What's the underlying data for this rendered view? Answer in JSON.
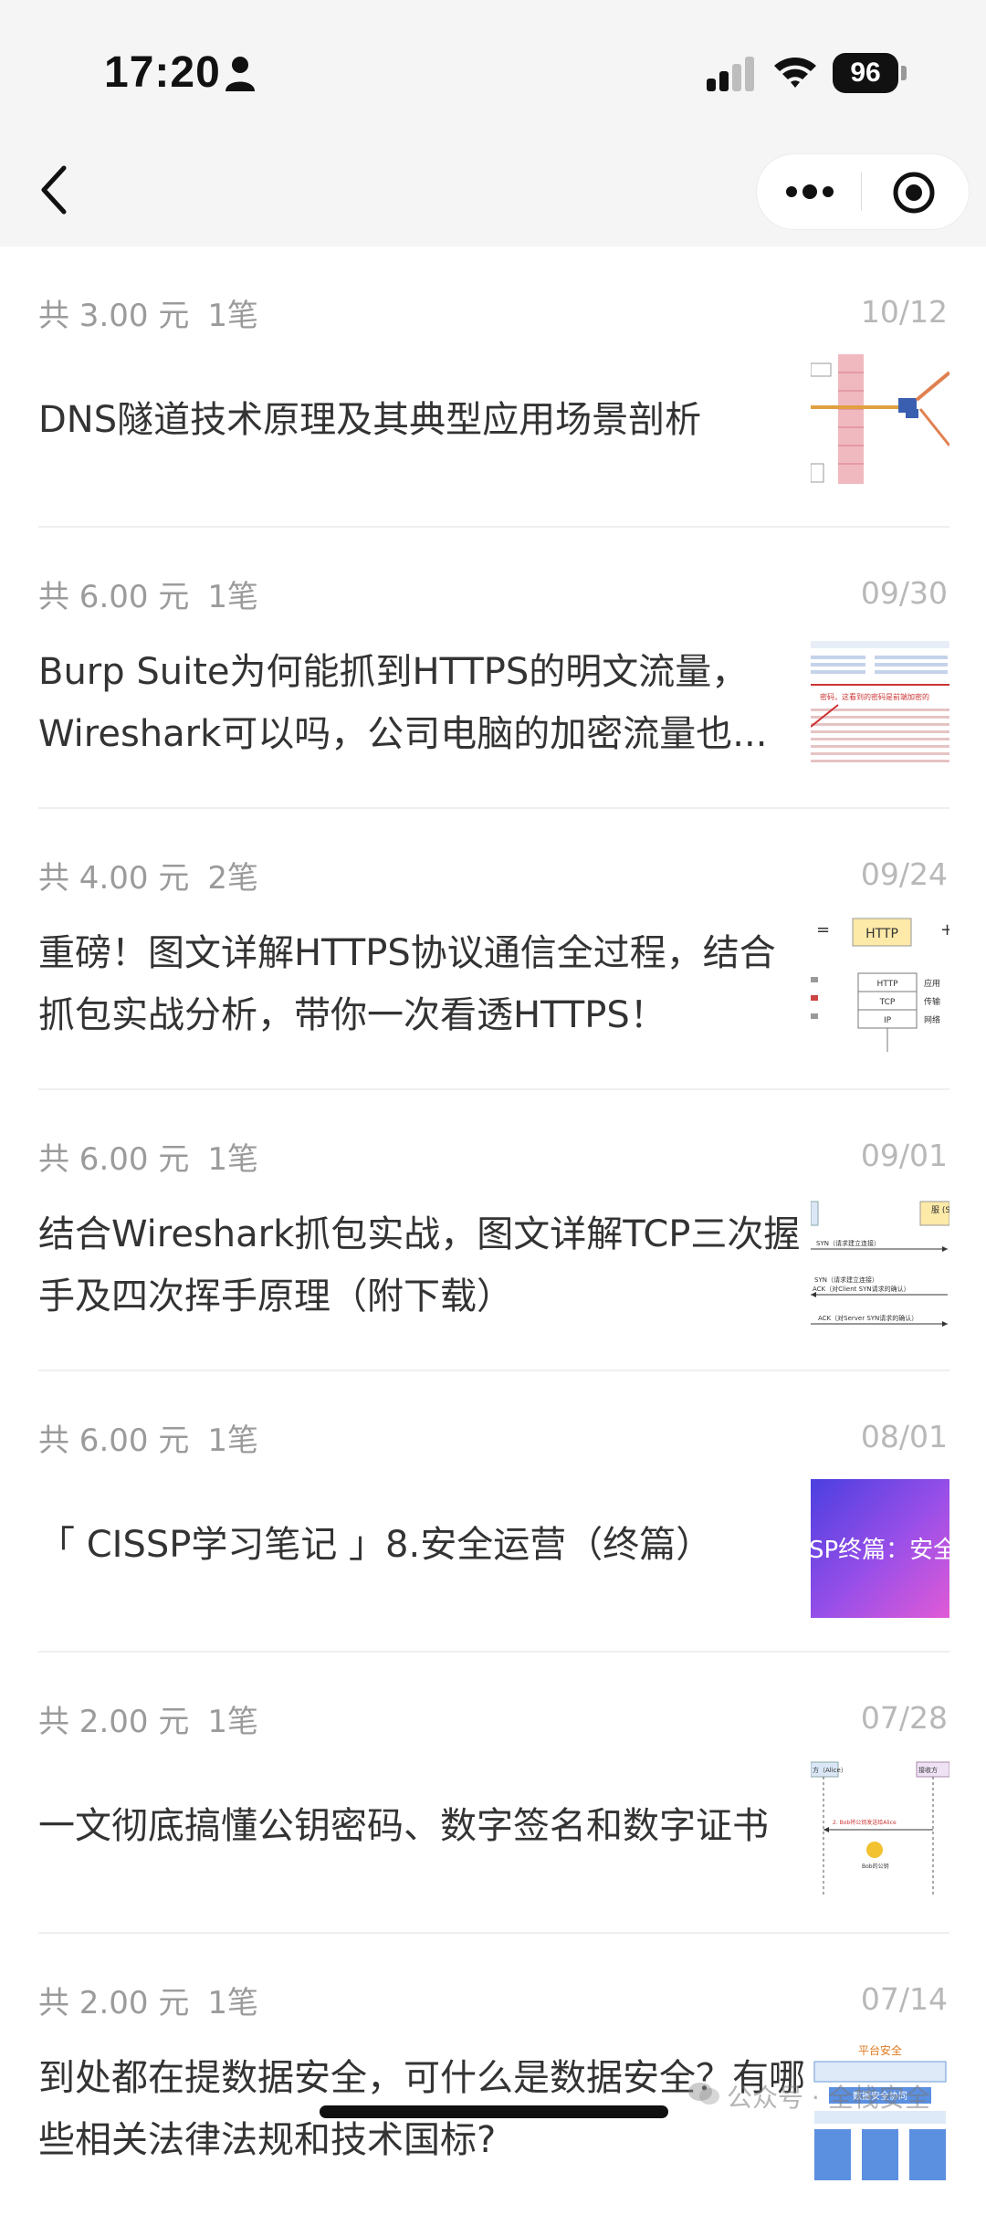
{
  "status_bar": {
    "time": "17:20",
    "battery": "96"
  },
  "nav": {
    "back_icon": "chevron-left-icon",
    "more_icon": "more-dots-icon",
    "target_icon": "target-icon"
  },
  "items": [
    {
      "amount": "共 3.00 元",
      "count": "1笔",
      "date": "10/12",
      "title": "DNS隧道技术原理及其典型应用场景剖析"
    },
    {
      "amount": "共 6.00 元",
      "count": "1笔",
      "date": "09/30",
      "title": "Burp Suite为何能抓到HTTPS的明文流量，Wireshark可以吗，公司电脑的加密流量也..."
    },
    {
      "amount": "共 4.00 元",
      "count": "2笔",
      "date": "09/24",
      "title": "重磅！图文详解HTTPS协议通信全过程，结合抓包实战分析，带你一次看透HTTPS！"
    },
    {
      "amount": "共 6.00 元",
      "count": "1笔",
      "date": "09/01",
      "title": "结合Wireshark抓包实战，图文详解TCP三次握手及四次挥手原理（附下载）"
    },
    {
      "amount": "共 6.00 元",
      "count": "1笔",
      "date": "08/01",
      "title": "「 CISSP学习笔记 」8.安全运营（终篇）"
    },
    {
      "amount": "共 2.00 元",
      "count": "1笔",
      "date": "07/28",
      "title": "一文彻底搞懂公钥密码、数字签名和数字证书"
    },
    {
      "amount": "共 2.00 元",
      "count": "1笔",
      "date": "07/14",
      "title": "到处都在提数据安全，可什么是数据安全？有哪些相关法律法规和技术国标?"
    }
  ],
  "thumb_text": {
    "t2": "密码，这看到的密码是前端加密的",
    "t3_http": "HTTP",
    "t3_tcp": "TCP",
    "t3_ip": "IP",
    "t3_eq": "=",
    "t3_plus": "+",
    "t3_r1": "应用",
    "t3_r2": "传输",
    "t3_r3": "网络",
    "t4_syn": "SYN（请求建立连接）",
    "t4_syn2": "SYN（请求建立连接）",
    "t4_ack": "ACK（对Client SYN请求的确认）",
    "t4_ack2": "ACK（对Server SYN请求的确认）",
    "t4_box": "服\n(Se",
    "t5": "SP终篇：安全",
    "t6_alice": "方（Alice）",
    "t6_bob": "接收方",
    "t6_mid": "2. Bob将公钥发送给Alice",
    "t6_key": "Bob的公钥",
    "t7_top": "平台安全",
    "t7_mid": "数据安全协同"
  },
  "watermark": "公众号 · 全栈安全"
}
